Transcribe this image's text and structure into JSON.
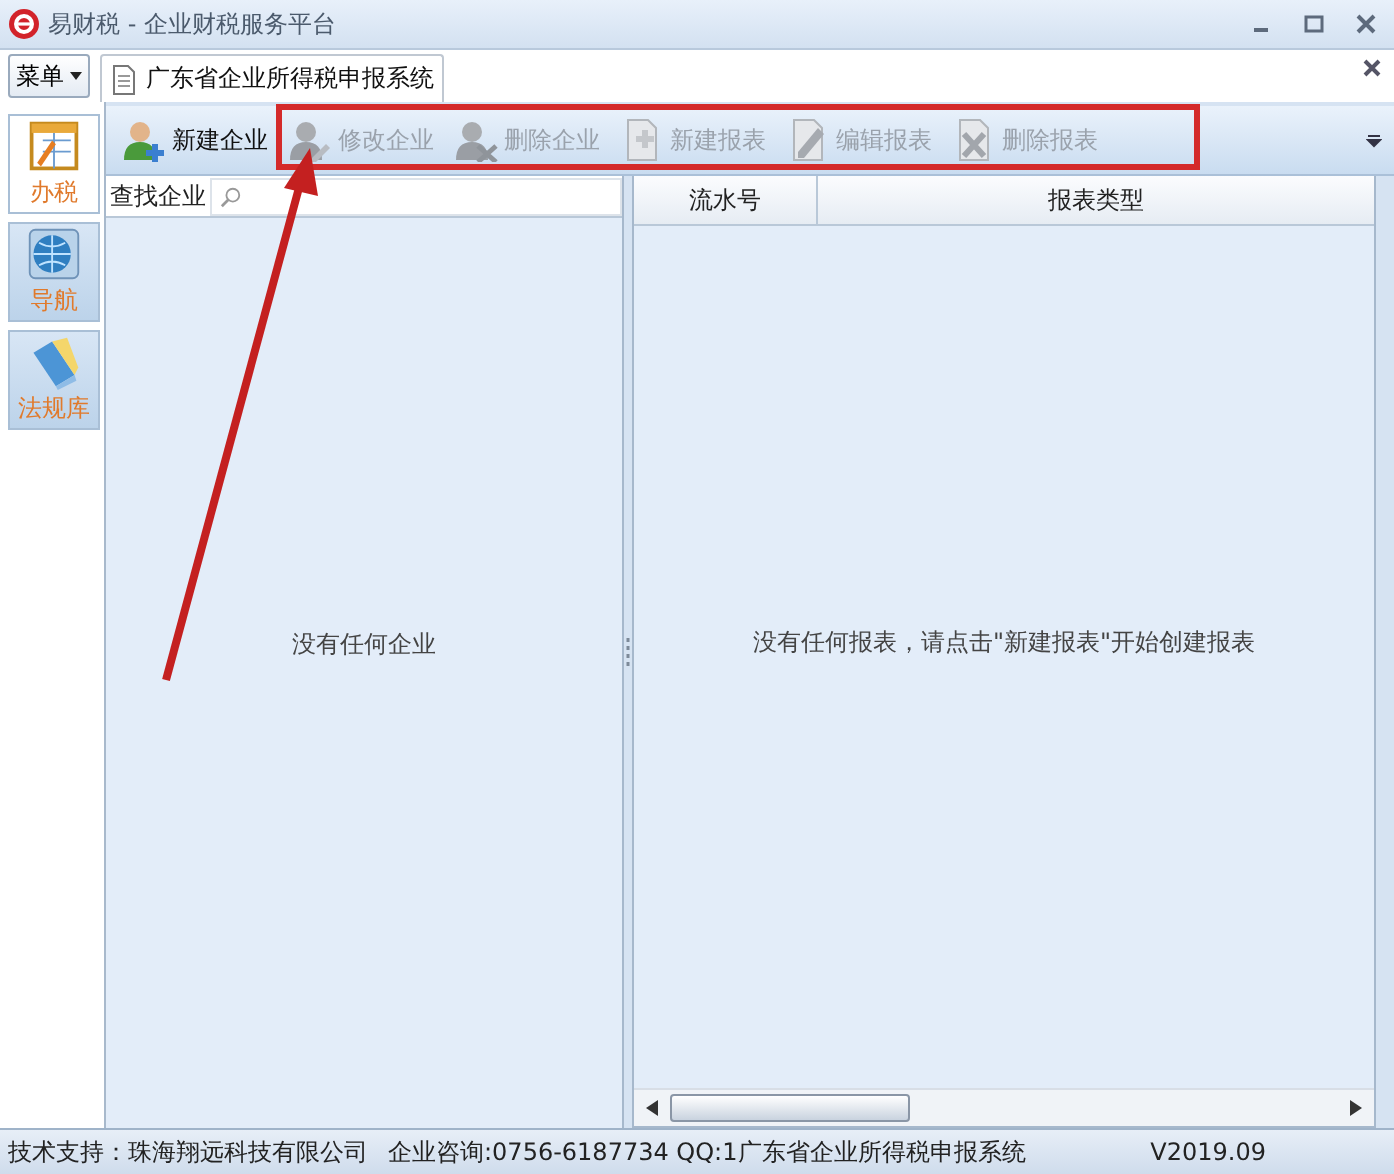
{
  "window": {
    "title": "易财税 - 企业财税服务平台"
  },
  "menu_button": {
    "label": "菜单"
  },
  "tabs": [
    {
      "label": "广东省企业所得税申报系统",
      "selected": true
    }
  ],
  "nav": [
    {
      "label": "办税",
      "kind": "form",
      "selected": true
    },
    {
      "label": "导航",
      "kind": "globe",
      "selected": false
    },
    {
      "label": "法规库",
      "kind": "book",
      "selected": false
    }
  ],
  "toolbar": [
    {
      "label": "新建企业",
      "kind": "add-user",
      "disabled": false
    },
    {
      "label": "修改企业",
      "kind": "edit-user",
      "disabled": true
    },
    {
      "label": "删除企业",
      "kind": "delete-user",
      "disabled": true
    },
    {
      "label": "新建报表",
      "kind": "add-doc",
      "disabled": true
    },
    {
      "label": "编辑报表",
      "kind": "edit-doc",
      "disabled": true
    },
    {
      "label": "删除报表",
      "kind": "delete-doc",
      "disabled": true
    }
  ],
  "company_panel": {
    "search_label": "查找企业",
    "empty_text": "没有任何企业"
  },
  "report_table": {
    "columns": [
      "流水号",
      "报表类型"
    ],
    "empty_text": "没有任何报表，请点击\"新建报表\"开始创建报表"
  },
  "status_bar": [
    "技术支持：珠海翔远科技有限公司",
    "企业咨询:0756-6187734 QQ:1",
    "广东省企业所得税申报系统",
    "V2019.09"
  ]
}
